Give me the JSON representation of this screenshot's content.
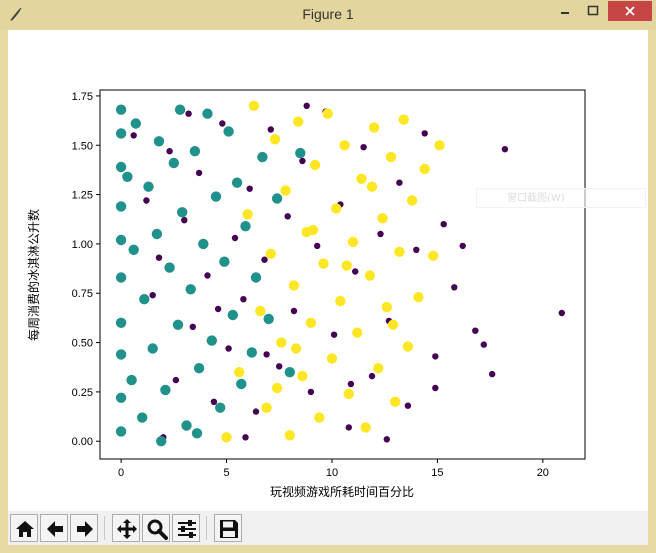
{
  "window": {
    "title": "Figure 1",
    "icons": {
      "app": "feather-icon",
      "minimize": "minimize-icon",
      "maximize": "maximize-icon",
      "close": "close-icon"
    }
  },
  "overlay": {
    "ghost_menu_label": "窗口截图(W)"
  },
  "toolbar": {
    "buttons": [
      {
        "name": "home-button",
        "icon": "home-icon"
      },
      {
        "name": "back-button",
        "icon": "arrow-left-icon"
      },
      {
        "name": "forward-button",
        "icon": "arrow-right-icon"
      },
      {
        "name": "pan-button",
        "icon": "move-icon"
      },
      {
        "name": "zoom-button",
        "icon": "magnifier-icon"
      },
      {
        "name": "configure-subplots-button",
        "icon": "sliders-icon"
      },
      {
        "name": "save-button",
        "icon": "floppy-disk-icon"
      }
    ]
  },
  "chart_data": {
    "type": "scatter",
    "title": "",
    "xlabel": "玩视频游戏所耗时间百分比",
    "ylabel": "每周消费的冰淇淋公升数",
    "xlim": [
      -1,
      22
    ],
    "ylim": [
      -0.09,
      1.78
    ],
    "xticks": [
      0,
      5,
      10,
      15,
      20
    ],
    "xtick_labels": [
      "0",
      "5",
      "10",
      "15",
      "20"
    ],
    "yticks": [
      0.0,
      0.25,
      0.5,
      0.75,
      1.0,
      1.25,
      1.5,
      1.75
    ],
    "ytick_labels": [
      "0.00",
      "0.25",
      "0.50",
      "0.75",
      "1.00",
      "1.25",
      "1.50",
      "1.75"
    ],
    "grid": false,
    "legend": "none",
    "series": [
      {
        "color": "#440154",
        "marker_size": "small",
        "points": [
          [
            0.6,
            1.55
          ],
          [
            1.2,
            1.22
          ],
          [
            1.8,
            0.93
          ],
          [
            2.3,
            1.47
          ],
          [
            2.6,
            0.31
          ],
          [
            3.0,
            1.12
          ],
          [
            3.4,
            0.58
          ],
          [
            3.7,
            1.36
          ],
          [
            4.1,
            0.84
          ],
          [
            4.4,
            0.2
          ],
          [
            4.8,
            1.61
          ],
          [
            5.1,
            0.47
          ],
          [
            5.4,
            1.03
          ],
          [
            5.8,
            0.72
          ],
          [
            6.1,
            1.28
          ],
          [
            6.4,
            0.15
          ],
          [
            6.8,
            0.92
          ],
          [
            7.1,
            1.58
          ],
          [
            7.5,
            0.38
          ],
          [
            7.9,
            1.14
          ],
          [
            8.2,
            0.66
          ],
          [
            8.6,
            1.42
          ],
          [
            9.0,
            0.25
          ],
          [
            9.3,
            0.99
          ],
          [
            9.7,
            1.67
          ],
          [
            10.1,
            0.54
          ],
          [
            10.4,
            1.2
          ],
          [
            10.8,
            0.07
          ],
          [
            11.1,
            0.86
          ],
          [
            11.5,
            1.49
          ],
          [
            11.9,
            0.33
          ],
          [
            12.3,
            1.05
          ],
          [
            12.7,
            0.61
          ],
          [
            13.2,
            1.31
          ],
          [
            13.6,
            0.18
          ],
          [
            14.0,
            0.97
          ],
          [
            14.4,
            1.56
          ],
          [
            14.9,
            0.43
          ],
          [
            15.3,
            1.1
          ],
          [
            15.8,
            0.78
          ],
          [
            16.2,
            0.99
          ],
          [
            16.8,
            0.56
          ],
          [
            17.2,
            0.49
          ],
          [
            17.6,
            0.34
          ],
          [
            18.2,
            1.48
          ],
          [
            20.9,
            0.65
          ],
          [
            2.0,
            0.02
          ],
          [
            3.2,
            1.66
          ],
          [
            5.9,
            0.02
          ],
          [
            8.8,
            1.7
          ],
          [
            12.6,
            0.01
          ],
          [
            14.9,
            0.27
          ],
          [
            4.6,
            0.67
          ],
          [
            1.5,
            0.74
          ],
          [
            6.9,
            0.44
          ],
          [
            10.9,
            0.29
          ]
        ]
      },
      {
        "color": "#21918c",
        "marker_size": "large",
        "points": [
          [
            0.0,
            0.05
          ],
          [
            0.0,
            0.22
          ],
          [
            0.0,
            0.44
          ],
          [
            0.0,
            0.6
          ],
          [
            0.0,
            0.83
          ],
          [
            0.0,
            1.02
          ],
          [
            0.0,
            1.19
          ],
          [
            0.0,
            1.39
          ],
          [
            0.0,
            1.56
          ],
          [
            0.0,
            1.68
          ],
          [
            0.5,
            0.31
          ],
          [
            0.6,
            0.97
          ],
          [
            0.7,
            1.61
          ],
          [
            1.0,
            0.12
          ],
          [
            1.1,
            0.72
          ],
          [
            1.3,
            1.29
          ],
          [
            1.5,
            0.47
          ],
          [
            1.7,
            1.05
          ],
          [
            1.8,
            1.52
          ],
          [
            2.1,
            0.26
          ],
          [
            2.3,
            0.88
          ],
          [
            2.5,
            1.41
          ],
          [
            2.7,
            0.59
          ],
          [
            2.9,
            1.16
          ],
          [
            3.1,
            0.08
          ],
          [
            3.3,
            0.77
          ],
          [
            3.5,
            1.47
          ],
          [
            3.7,
            0.37
          ],
          [
            3.9,
            1.0
          ],
          [
            4.1,
            1.66
          ],
          [
            4.3,
            0.51
          ],
          [
            4.5,
            1.24
          ],
          [
            4.7,
            0.17
          ],
          [
            4.9,
            0.91
          ],
          [
            5.1,
            1.57
          ],
          [
            5.3,
            0.64
          ],
          [
            5.5,
            1.31
          ],
          [
            5.7,
            0.29
          ],
          [
            5.9,
            1.09
          ],
          [
            6.2,
            0.45
          ],
          [
            6.4,
            0.83
          ],
          [
            6.7,
            1.44
          ],
          [
            7.0,
            0.62
          ],
          [
            7.4,
            1.23
          ],
          [
            8.0,
            0.35
          ],
          [
            8.5,
            1.46
          ],
          [
            0.3,
            1.34
          ],
          [
            1.9,
            0.0
          ],
          [
            3.6,
            0.04
          ],
          [
            2.8,
            1.68
          ]
        ]
      },
      {
        "color": "#fde725",
        "marker_size": "large",
        "points": [
          [
            5.0,
            0.02
          ],
          [
            5.6,
            0.35
          ],
          [
            6.0,
            1.15
          ],
          [
            6.3,
            1.7
          ],
          [
            6.6,
            0.66
          ],
          [
            6.9,
            0.17
          ],
          [
            7.1,
            0.95
          ],
          [
            7.3,
            1.53
          ],
          [
            7.6,
            0.5
          ],
          [
            7.8,
            1.27
          ],
          [
            8.0,
            0.03
          ],
          [
            8.2,
            0.79
          ],
          [
            8.4,
            1.62
          ],
          [
            8.6,
            0.33
          ],
          [
            8.8,
            1.06
          ],
          [
            9.0,
            0.6
          ],
          [
            9.2,
            1.4
          ],
          [
            9.4,
            0.12
          ],
          [
            9.6,
            0.9
          ],
          [
            9.8,
            1.66
          ],
          [
            10.0,
            0.42
          ],
          [
            10.2,
            1.18
          ],
          [
            10.4,
            0.71
          ],
          [
            10.6,
            1.5
          ],
          [
            10.8,
            0.24
          ],
          [
            11.0,
            1.01
          ],
          [
            11.2,
            0.55
          ],
          [
            11.4,
            1.33
          ],
          [
            11.6,
            0.07
          ],
          [
            11.8,
            0.84
          ],
          [
            12.0,
            1.59
          ],
          [
            12.2,
            0.37
          ],
          [
            12.4,
            1.13
          ],
          [
            12.6,
            0.68
          ],
          [
            12.8,
            1.44
          ],
          [
            13.0,
            0.2
          ],
          [
            13.2,
            0.96
          ],
          [
            13.4,
            1.63
          ],
          [
            13.6,
            0.48
          ],
          [
            13.8,
            1.22
          ],
          [
            14.1,
            0.73
          ],
          [
            14.4,
            1.38
          ],
          [
            14.8,
            0.94
          ],
          [
            15.1,
            1.5
          ],
          [
            9.1,
            1.07
          ],
          [
            10.7,
            0.89
          ],
          [
            11.9,
            1.29
          ],
          [
            8.3,
            0.47
          ],
          [
            12.9,
            0.59
          ],
          [
            7.4,
            0.27
          ]
        ]
      }
    ]
  }
}
